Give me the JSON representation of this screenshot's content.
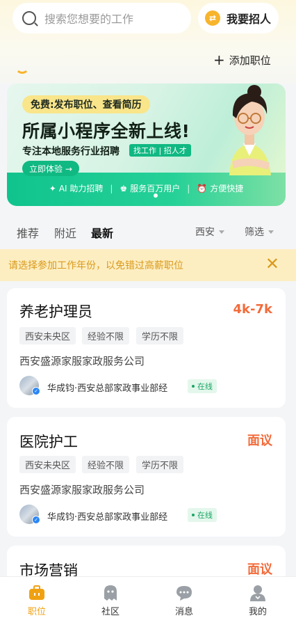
{
  "header": {
    "search_placeholder": "搜索您想要的工作",
    "recruit_label": "我要招人",
    "add_job_label": "添加职位"
  },
  "banner": {
    "free_tag": "免费:发布职位、查看简历",
    "title": "所属小程序全新上线!",
    "subtitle": "专注本地服务行业招聘",
    "pill": "找工作 | 招人才",
    "try_label": "立即体验 →",
    "features": [
      "AI 助力招聘",
      "服务百万用户",
      "方便快捷"
    ]
  },
  "tabs": {
    "items": [
      "推荐",
      "附近",
      "最新"
    ],
    "active": "最新",
    "city": "西安",
    "filter": "筛选"
  },
  "notice": {
    "text": "请选择参加工作年份，以免错过高薪职位"
  },
  "jobs": [
    {
      "title": "养老护理员",
      "salary": "4k-7k",
      "tags": [
        "西安未央区",
        "经验不限",
        "学历不限"
      ],
      "company": "西安盛源家服家政服务公司",
      "recruiter": "华成钧·西安总部家政事业部经",
      "status": "在线"
    },
    {
      "title": "医院护工",
      "salary": "面议",
      "tags": [
        "西安未央区",
        "经验不限",
        "学历不限"
      ],
      "company": "西安盛源家服家政服务公司",
      "recruiter": "华成钧·西安总部家政事业部经",
      "status": "在线"
    },
    {
      "title": "市场营销",
      "salary": "面议"
    }
  ],
  "nav": {
    "items": [
      "职位",
      "社区",
      "消息",
      "我的"
    ],
    "active": "职位"
  },
  "colors": {
    "accent": "#f0a112",
    "salary": "#f26b3a",
    "banner_green": "#10c38d",
    "notice_bg": "#fdeec2"
  }
}
